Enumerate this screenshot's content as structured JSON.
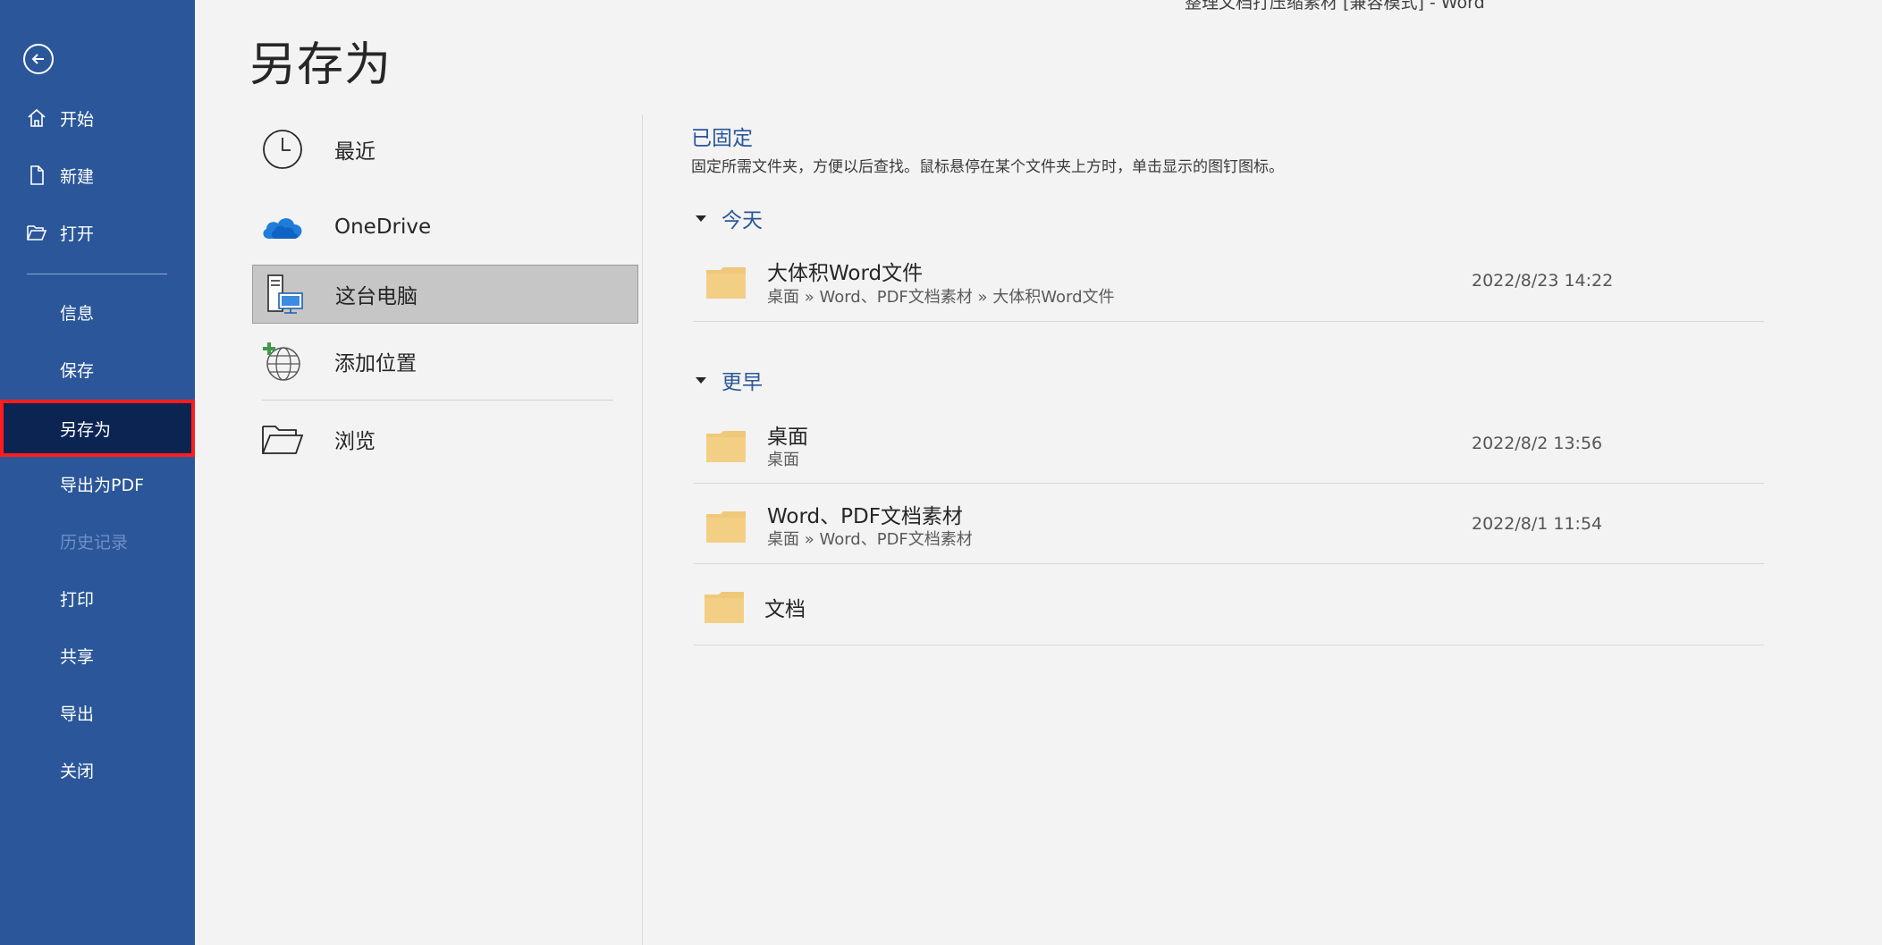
{
  "window": {
    "doc_title": "整理文档打压缩素材 [兼容模式] - Word"
  },
  "nav": {
    "items": [
      {
        "label": "开始",
        "icon": "home-icon"
      },
      {
        "label": "新建",
        "icon": "new-doc-icon"
      },
      {
        "label": "打开",
        "icon": "open-folder-icon"
      },
      {
        "label": "信息"
      },
      {
        "label": "保存"
      },
      {
        "label": "另存为",
        "selected": true
      },
      {
        "label": "导出为PDF"
      },
      {
        "label": "历史记录",
        "disabled": true
      },
      {
        "label": "打印"
      },
      {
        "label": "共享"
      },
      {
        "label": "导出"
      },
      {
        "label": "关闭"
      }
    ]
  },
  "page": {
    "title": "另存为"
  },
  "locations": [
    {
      "label": "最近",
      "icon": "clock-icon"
    },
    {
      "label": "OneDrive",
      "icon": "onedrive-cloud-icon"
    },
    {
      "label": "这台电脑",
      "icon": "this-pc-icon",
      "selected": true
    },
    {
      "label": "添加位置",
      "icon": "add-location-globe-icon"
    },
    {
      "label": "浏览",
      "icon": "browse-folder-icon"
    }
  ],
  "pinned": {
    "title": "已固定",
    "description": "固定所需文件夹，方便以后查找。鼠标悬停在某个文件夹上方时，单击显示的图钉图标。"
  },
  "groups": {
    "today": {
      "label": "今天",
      "folders": [
        {
          "name": "大体积Word文件",
          "path": "桌面 » Word、PDF文档素材 » 大体积Word文件",
          "date": "2022/8/23 14:22"
        }
      ]
    },
    "earlier": {
      "label": "更早",
      "folders": [
        {
          "name": "桌面",
          "path": "桌面",
          "date": "2022/8/2 13:56"
        },
        {
          "name": "Word、PDF文档素材",
          "path": "桌面 » Word、PDF文档素材",
          "date": "2022/8/1 11:54"
        },
        {
          "name": "文档",
          "path": "",
          "date": ""
        }
      ]
    }
  },
  "colors": {
    "nav_bg": "#2b579a",
    "nav_selected_bg": "#0b2452",
    "highlight_border": "#ff1d1d",
    "accent": "#2b579a",
    "folder": "#f0c87a"
  }
}
